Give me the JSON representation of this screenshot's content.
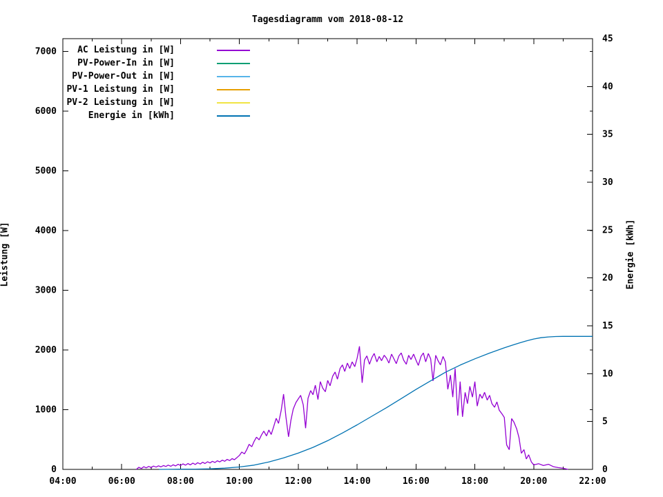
{
  "chart_data": {
    "type": "line",
    "title": "Tagesdiagramm vom 2018-08-12",
    "ylabel": "Leistung [W]",
    "y2label": "Energie [kWh]",
    "x_axis": {
      "range_hours": [
        4,
        22
      ],
      "major_tick_labels": [
        "04:00",
        "06:00",
        "08:00",
        "10:00",
        "12:00",
        "14:00",
        "16:00",
        "18:00",
        "20:00",
        "22:00"
      ],
      "major_tick_hours": [
        4,
        6,
        8,
        10,
        12,
        14,
        16,
        18,
        20,
        22
      ],
      "minor_tick_every_hours": 1
    },
    "y_axis": {
      "range": [
        0,
        7211
      ],
      "tick_labels": [
        "0",
        "1000",
        "2000",
        "3000",
        "4000",
        "5000",
        "6000",
        "7000"
      ],
      "tick_values": [
        0,
        1000,
        2000,
        3000,
        4000,
        5000,
        6000,
        7000
      ]
    },
    "y2_axis": {
      "range": [
        0,
        45
      ],
      "tick_labels": [
        "0",
        "5",
        "10",
        "15",
        "20",
        "25",
        "30",
        "35",
        "40",
        "45"
      ],
      "tick_values": [
        0,
        5,
        10,
        15,
        20,
        25,
        30,
        35,
        40,
        45
      ]
    },
    "grid": false,
    "legend_position": "top-left-inside",
    "series": [
      {
        "name": "AC Leistung in [W]",
        "color": "#9400d3",
        "axis": "y1",
        "visible": true,
        "points": [
          [
            6.5,
            0
          ],
          [
            6.58,
            35
          ],
          [
            6.67,
            15
          ],
          [
            6.75,
            45
          ],
          [
            6.83,
            25
          ],
          [
            6.92,
            50
          ],
          [
            7.0,
            30
          ],
          [
            7.08,
            55
          ],
          [
            7.17,
            38
          ],
          [
            7.25,
            60
          ],
          [
            7.33,
            42
          ],
          [
            7.42,
            65
          ],
          [
            7.5,
            48
          ],
          [
            7.58,
            72
          ],
          [
            7.67,
            52
          ],
          [
            7.75,
            78
          ],
          [
            7.83,
            58
          ],
          [
            7.92,
            85
          ],
          [
            8.0,
            65
          ],
          [
            8.08,
            92
          ],
          [
            8.17,
            70
          ],
          [
            8.25,
            98
          ],
          [
            8.33,
            76
          ],
          [
            8.42,
            105
          ],
          [
            8.5,
            82
          ],
          [
            8.58,
            112
          ],
          [
            8.67,
            90
          ],
          [
            8.75,
            120
          ],
          [
            8.83,
            98
          ],
          [
            8.92,
            128
          ],
          [
            9.0,
            108
          ],
          [
            9.08,
            135
          ],
          [
            9.17,
            115
          ],
          [
            9.25,
            145
          ],
          [
            9.33,
            125
          ],
          [
            9.42,
            155
          ],
          [
            9.5,
            135
          ],
          [
            9.58,
            168
          ],
          [
            9.67,
            148
          ],
          [
            9.75,
            180
          ],
          [
            9.83,
            162
          ],
          [
            9.92,
            200
          ],
          [
            10.0,
            235
          ],
          [
            10.08,
            290
          ],
          [
            10.17,
            260
          ],
          [
            10.25,
            330
          ],
          [
            10.33,
            420
          ],
          [
            10.42,
            380
          ],
          [
            10.5,
            470
          ],
          [
            10.58,
            540
          ],
          [
            10.67,
            495
          ],
          [
            10.75,
            575
          ],
          [
            10.83,
            640
          ],
          [
            10.92,
            560
          ],
          [
            11.0,
            660
          ],
          [
            11.08,
            585
          ],
          [
            11.17,
            725
          ],
          [
            11.25,
            855
          ],
          [
            11.33,
            770
          ],
          [
            11.42,
            990
          ],
          [
            11.5,
            1260
          ],
          [
            11.58,
            880
          ],
          [
            11.67,
            545
          ],
          [
            11.75,
            820
          ],
          [
            11.83,
            1010
          ],
          [
            11.92,
            1120
          ],
          [
            12.0,
            1180
          ],
          [
            12.08,
            1240
          ],
          [
            12.17,
            1080
          ],
          [
            12.25,
            690
          ],
          [
            12.33,
            1190
          ],
          [
            12.42,
            1320
          ],
          [
            12.5,
            1250
          ],
          [
            12.58,
            1410
          ],
          [
            12.67,
            1170
          ],
          [
            12.75,
            1470
          ],
          [
            12.83,
            1360
          ],
          [
            12.92,
            1300
          ],
          [
            13.0,
            1490
          ],
          [
            13.08,
            1400
          ],
          [
            13.17,
            1560
          ],
          [
            13.25,
            1630
          ],
          [
            13.33,
            1510
          ],
          [
            13.42,
            1690
          ],
          [
            13.5,
            1750
          ],
          [
            13.58,
            1640
          ],
          [
            13.67,
            1780
          ],
          [
            13.75,
            1690
          ],
          [
            13.83,
            1800
          ],
          [
            13.92,
            1720
          ],
          [
            14.0,
            1860
          ],
          [
            14.08,
            2060
          ],
          [
            14.17,
            1450
          ],
          [
            14.25,
            1830
          ],
          [
            14.33,
            1900
          ],
          [
            14.42,
            1760
          ],
          [
            14.5,
            1870
          ],
          [
            14.58,
            1940
          ],
          [
            14.67,
            1800
          ],
          [
            14.75,
            1890
          ],
          [
            14.83,
            1820
          ],
          [
            14.92,
            1910
          ],
          [
            15.0,
            1860
          ],
          [
            15.08,
            1780
          ],
          [
            15.17,
            1930
          ],
          [
            15.25,
            1850
          ],
          [
            15.33,
            1770
          ],
          [
            15.42,
            1900
          ],
          [
            15.5,
            1950
          ],
          [
            15.58,
            1830
          ],
          [
            15.67,
            1760
          ],
          [
            15.75,
            1910
          ],
          [
            15.83,
            1840
          ],
          [
            15.92,
            1930
          ],
          [
            16.0,
            1830
          ],
          [
            16.08,
            1740
          ],
          [
            16.17,
            1890
          ],
          [
            16.25,
            1950
          ],
          [
            16.33,
            1800
          ],
          [
            16.42,
            1940
          ],
          [
            16.5,
            1850
          ],
          [
            16.58,
            1480
          ],
          [
            16.67,
            1910
          ],
          [
            16.75,
            1820
          ],
          [
            16.83,
            1750
          ],
          [
            16.92,
            1890
          ],
          [
            17.0,
            1800
          ],
          [
            17.08,
            1340
          ],
          [
            17.17,
            1580
          ],
          [
            17.25,
            1210
          ],
          [
            17.33,
            1690
          ],
          [
            17.42,
            900
          ],
          [
            17.5,
            1470
          ],
          [
            17.58,
            880
          ],
          [
            17.67,
            1290
          ],
          [
            17.75,
            1100
          ],
          [
            17.83,
            1390
          ],
          [
            17.92,
            1210
          ],
          [
            18.0,
            1470
          ],
          [
            18.08,
            1060
          ],
          [
            18.17,
            1260
          ],
          [
            18.25,
            1190
          ],
          [
            18.33,
            1290
          ],
          [
            18.42,
            1160
          ],
          [
            18.5,
            1240
          ],
          [
            18.58,
            1100
          ],
          [
            18.67,
            1040
          ],
          [
            18.75,
            1130
          ],
          [
            18.83,
            990
          ],
          [
            18.92,
            930
          ],
          [
            19.0,
            870
          ],
          [
            19.08,
            410
          ],
          [
            19.17,
            330
          ],
          [
            19.25,
            850
          ],
          [
            19.33,
            790
          ],
          [
            19.42,
            680
          ],
          [
            19.5,
            530
          ],
          [
            19.58,
            270
          ],
          [
            19.67,
            330
          ],
          [
            19.75,
            175
          ],
          [
            19.83,
            245
          ],
          [
            19.92,
            125
          ],
          [
            20.0,
            75
          ],
          [
            20.17,
            95
          ],
          [
            20.33,
            65
          ],
          [
            20.5,
            85
          ],
          [
            20.67,
            45
          ],
          [
            20.83,
            30
          ],
          [
            21.0,
            18
          ],
          [
            21.17,
            0
          ]
        ]
      },
      {
        "name": "PV-Power-In in [W]",
        "color": "#009e73",
        "axis": "y1",
        "visible": false,
        "points": []
      },
      {
        "name": "PV-Power-Out in [W]",
        "color": "#56b4e9",
        "axis": "y1",
        "visible": false,
        "points": []
      },
      {
        "name": "PV-1 Leistung in [W]",
        "color": "#e69f00",
        "axis": "y1",
        "visible": false,
        "points": []
      },
      {
        "name": "PV-2 Leistung in [W]",
        "color": "#f0e442",
        "axis": "y1",
        "visible": false,
        "points": []
      },
      {
        "name": "Energie in [kWh]",
        "color": "#0072b2",
        "axis": "y2",
        "visible": true,
        "points": [
          [
            7.27,
            0.0
          ],
          [
            8.0,
            0.02
          ],
          [
            8.5,
            0.03
          ],
          [
            9.0,
            0.06
          ],
          [
            9.5,
            0.13
          ],
          [
            10.0,
            0.25
          ],
          [
            10.5,
            0.45
          ],
          [
            11.0,
            0.78
          ],
          [
            11.5,
            1.2
          ],
          [
            12.0,
            1.7
          ],
          [
            12.5,
            2.3
          ],
          [
            13.0,
            3.0
          ],
          [
            13.5,
            3.8
          ],
          [
            14.0,
            4.65
          ],
          [
            14.5,
            5.55
          ],
          [
            15.0,
            6.45
          ],
          [
            15.5,
            7.4
          ],
          [
            16.0,
            8.35
          ],
          [
            16.5,
            9.25
          ],
          [
            17.0,
            10.15
          ],
          [
            17.5,
            10.9
          ],
          [
            18.0,
            11.55
          ],
          [
            18.5,
            12.15
          ],
          [
            19.0,
            12.7
          ],
          [
            19.25,
            12.95
          ],
          [
            19.5,
            13.2
          ],
          [
            19.75,
            13.42
          ],
          [
            20.0,
            13.62
          ],
          [
            20.25,
            13.76
          ],
          [
            20.5,
            13.84
          ],
          [
            20.75,
            13.88
          ],
          [
            21.0,
            13.9
          ],
          [
            21.5,
            13.9
          ],
          [
            22.0,
            13.9
          ]
        ]
      }
    ]
  }
}
